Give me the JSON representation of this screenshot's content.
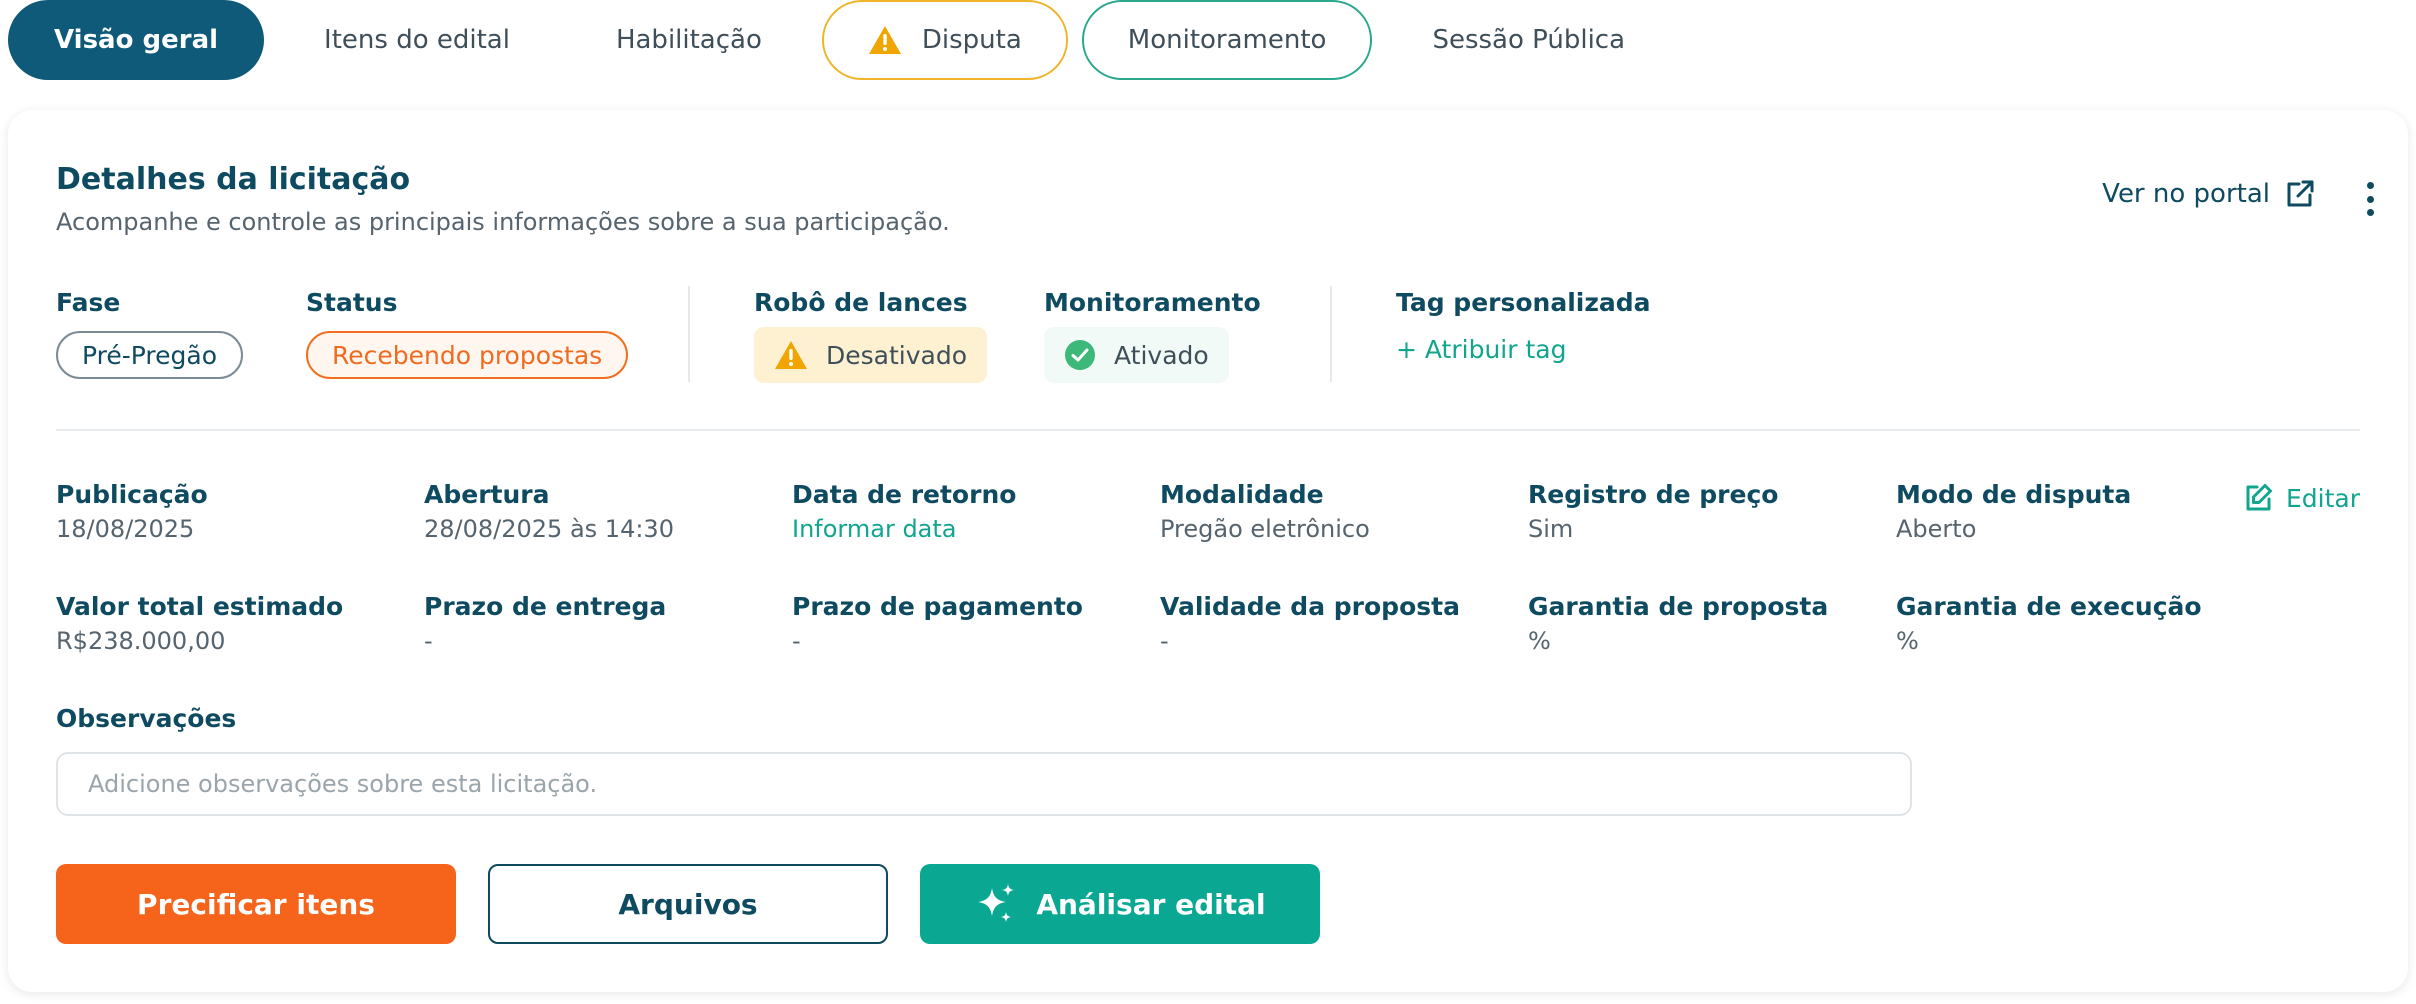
{
  "tabs": [
    {
      "label": "Visão geral"
    },
    {
      "label": "Itens do edital"
    },
    {
      "label": "Habilitação"
    },
    {
      "label": "Disputa"
    },
    {
      "label": "Monitoramento"
    },
    {
      "label": "Sessão Pública"
    }
  ],
  "card": {
    "title": "Detalhes da licitação",
    "subtitle": "Acompanhe e controle as principais informações sobre a sua participação.",
    "portal_link": "Ver no portal"
  },
  "summary": {
    "phase": {
      "label": "Fase",
      "value": "Pré-Pregão"
    },
    "status": {
      "label": "Status",
      "value": "Recebendo propostas"
    },
    "robot": {
      "label": "Robô de lances",
      "value": "Desativado"
    },
    "monitoring": {
      "label": "Monitoramento",
      "value": "Ativado"
    },
    "tag": {
      "label": "Tag personalizada",
      "action": "+ Atribuir tag"
    }
  },
  "details": {
    "edit_label": "Editar",
    "row1": [
      {
        "label": "Publicação",
        "value": "18/08/2025"
      },
      {
        "label": "Abertura",
        "value": "28/08/2025 às 14:30"
      },
      {
        "label": "Data de retorno",
        "value": "Informar data"
      },
      {
        "label": "Modalidade",
        "value": "Pregão eletrônico"
      },
      {
        "label": "Registro de preço",
        "value": "Sim"
      },
      {
        "label": "Modo de disputa",
        "value": "Aberto"
      }
    ],
    "row2": [
      {
        "label": "Valor total estimado",
        "value": "R$238.000,00"
      },
      {
        "label": "Prazo de entrega",
        "value": "-"
      },
      {
        "label": "Prazo de pagamento",
        "value": "-"
      },
      {
        "label": "Validade da proposta",
        "value": "-"
      },
      {
        "label": "Garantia de proposta",
        "value": "%"
      },
      {
        "label": "Garantia de execução",
        "value": "%"
      }
    ]
  },
  "observations": {
    "label": "Observações",
    "value": "",
    "placeholder": "Adicione observações sobre esta licitação."
  },
  "actions": {
    "price_items": "Precificar itens",
    "files": "Arquivos",
    "analyze": "Análisar edital"
  },
  "colors": {
    "primary": "#0e5a78",
    "accent_orange": "#f5641a",
    "accent_teal": "#0aa893",
    "warning": "#f0b429"
  },
  "icons": [
    "warning-icon",
    "external-link-icon",
    "more-vertical-icon",
    "check-circle-icon",
    "edit-icon",
    "sparkles-icon"
  ]
}
